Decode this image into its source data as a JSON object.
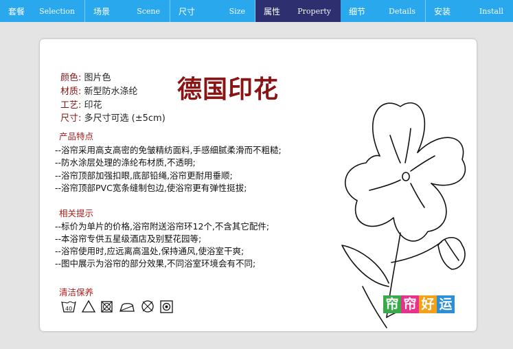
{
  "nav": {
    "tabs": [
      {
        "cn": "套餐",
        "en": "Selection"
      },
      {
        "cn": "场景",
        "en": "Scene"
      },
      {
        "cn": "尺寸",
        "en": "Size"
      },
      {
        "cn": "属性",
        "en": "Property",
        "active": true
      },
      {
        "cn": "细节",
        "en": "Details"
      },
      {
        "cn": "安装",
        "en": "Install"
      }
    ]
  },
  "card": {
    "title": "德国印花",
    "specs": [
      {
        "k": "颜色:",
        "v": "图片色"
      },
      {
        "k": "材质:",
        "v": "新型防水涤纶"
      },
      {
        "k": "工艺:",
        "v": "印花"
      },
      {
        "k": "尺寸:",
        "v": "多尺寸可选 (±5cm)"
      }
    ],
    "features_title": "产品特点",
    "features": [
      "--浴帘采用高支高密的免皱精纺面料,手感细腻柔滑而不粗糙;",
      "--防水涂层处理的涤纶布材质,不透明;",
      "--浴帘顶部加强扣眼,底部铅绳,浴帘更耐用垂顺;",
      "--浴帘顶部PVC宽条缝制包边,使浴帘更有弹性挺拔;"
    ],
    "tips_title": "相关提示",
    "tips": [
      "--标价为单片的价格,浴帘附送浴帘环12个,不含其它配件;",
      "--本浴帘专供五星级酒店及别墅花园等;",
      "--浴帘使用时,应远离高温处,保持通风,使浴室干爽;",
      "--图中展示为浴帘的部分效果,不同浴室环境会有不同;"
    ],
    "care_title": "清洁保养",
    "care_icons": [
      "wash-40-icon",
      "no-bleach-icon",
      "no-tumble-dry-icon",
      "iron-icon",
      "no-dry-clean-icon",
      "dry-icon"
    ],
    "logo_chars": [
      "帘",
      "帘",
      "好",
      "运"
    ],
    "logo_colors": [
      "#3aa94a",
      "#e7318a",
      "#f2a11b",
      "#2a8fd6"
    ]
  }
}
